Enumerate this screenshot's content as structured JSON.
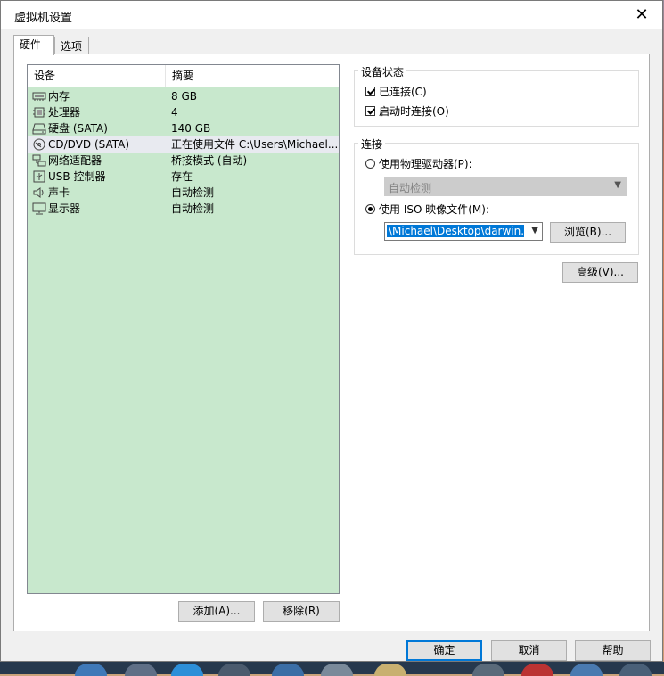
{
  "window": {
    "title": "虚拟机设置"
  },
  "tabs": [
    {
      "label": "硬件",
      "active": true
    },
    {
      "label": "选项",
      "active": false
    }
  ],
  "device_list": {
    "columns": [
      "设备",
      "摘要"
    ],
    "rows": [
      {
        "icon": "memory-icon",
        "device": "内存",
        "summary": "8 GB"
      },
      {
        "icon": "processor-icon",
        "device": "处理器",
        "summary": "4"
      },
      {
        "icon": "hard-disk-icon",
        "device": "硬盘 (SATA)",
        "summary": "140 GB"
      },
      {
        "icon": "cd-dvd-icon",
        "device": "CD/DVD (SATA)",
        "summary": "正在使用文件 C:\\Users\\Michael...",
        "selected": true
      },
      {
        "icon": "network-adapter-icon",
        "device": "网络适配器",
        "summary": "桥接模式 (自动)"
      },
      {
        "icon": "usb-icon",
        "device": "USB 控制器",
        "summary": "存在"
      },
      {
        "icon": "sound-card-icon",
        "device": "声卡",
        "summary": "自动检测"
      },
      {
        "icon": "display-icon",
        "device": "显示器",
        "summary": "自动检测"
      }
    ]
  },
  "list_buttons": {
    "add": "添加(A)...",
    "remove": "移除(R)"
  },
  "device_status": {
    "title": "设备状态",
    "connected": {
      "label": "已连接(C)",
      "checked": true
    },
    "connect_at_power_on": {
      "label": "启动时连接(O)",
      "checked": true
    }
  },
  "connection": {
    "title": "连接",
    "physical_drive": {
      "label": "使用物理驱动器(P):",
      "selected": false
    },
    "physical_drive_select": {
      "value": "自动检测",
      "disabled": true
    },
    "iso_image": {
      "label": "使用 ISO 映像文件(M):",
      "selected": true
    },
    "iso_path": {
      "value": "\\Michael\\Desktop\\darwin.iso"
    },
    "browse": "浏览(B)..."
  },
  "advanced": "高级(V)...",
  "footer": {
    "ok": "确定",
    "cancel": "取消",
    "help": "帮助"
  },
  "colors": {
    "list_bg": "#c8e8cd",
    "accent": "#0078d7",
    "selected_row": "#e8eaf0"
  }
}
